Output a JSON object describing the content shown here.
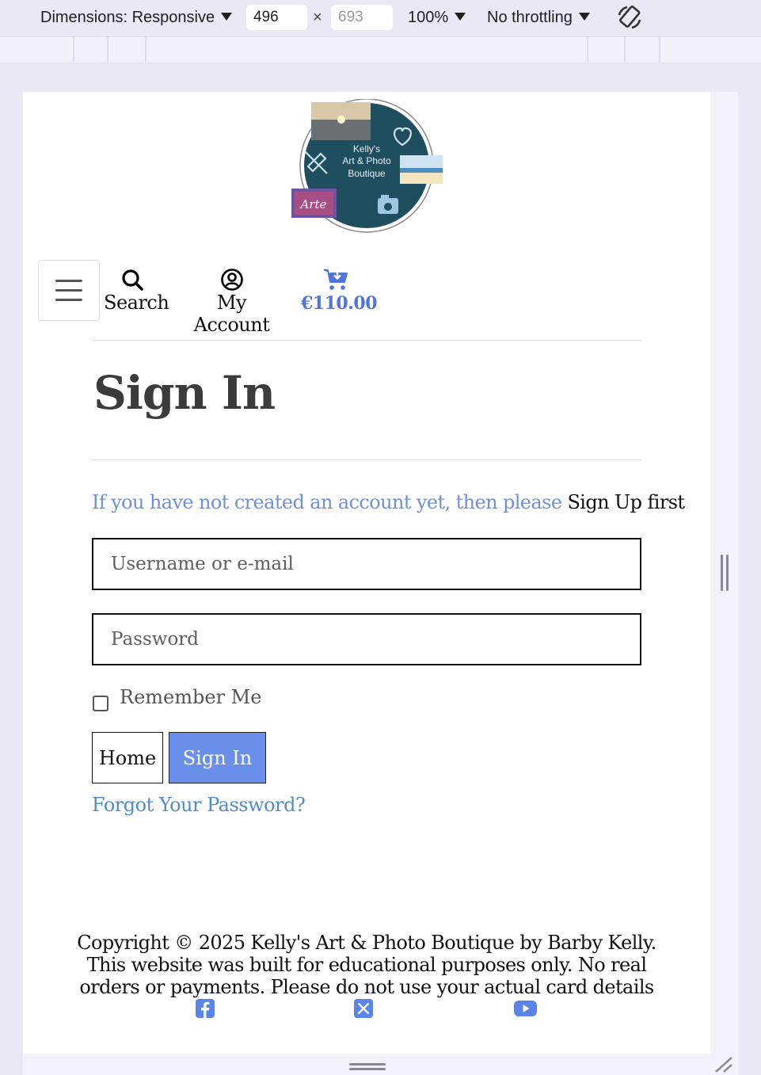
{
  "devtools": {
    "dimensions_label": "Dimensions: Responsive",
    "width": "496",
    "height_placeholder": "693",
    "times": "×",
    "zoom": "100%",
    "throttling": "No throttling"
  },
  "nav": {
    "search_label": "Search",
    "account_label": "My Account",
    "cart_total": "€110.00"
  },
  "logo": {
    "line1": "Kelly's",
    "line2": "Art & Photo",
    "line3": "Boutique",
    "badge": "Arte"
  },
  "page": {
    "title": "Sign In",
    "notice_soft": "If you have not created an account yet, then please ",
    "notice_link": "Sign Up",
    "notice_end": " first",
    "username_placeholder": "Username or e-mail",
    "password_placeholder": "Password",
    "remember_label": "Remember Me",
    "home_button": "Home",
    "signin_button": "Sign In",
    "forgot_link": "Forgot Your Password?"
  },
  "footer": {
    "copyright": "Copyright © 2025 Kelly's Art & Photo Boutique by Barby Kelly. This website was built for educational purposes only. No real orders or payments. Please do not use your actual card details",
    "social": [
      "facebook-icon",
      "x-twitter-icon",
      "youtube-icon"
    ]
  },
  "colors": {
    "accent": "#6a8fea",
    "link": "#4f8cc9",
    "cart": "#4f74db",
    "logo_circle": "#1f4e5f"
  }
}
